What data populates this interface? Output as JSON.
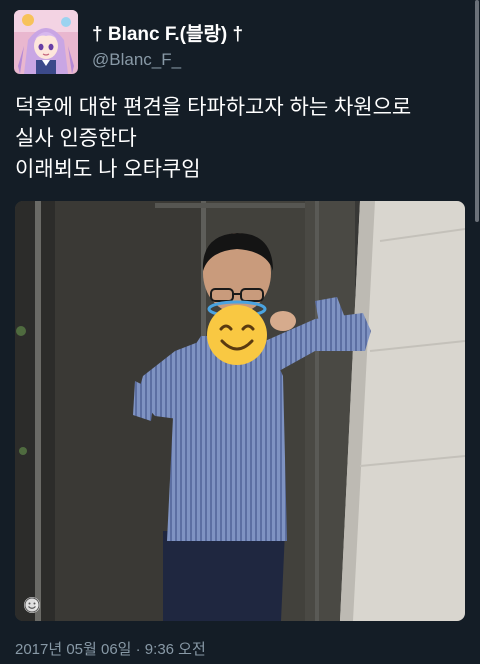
{
  "tweet": {
    "author_name": "† Blanc F.(블랑) †",
    "author_handle": "@Blanc_F_",
    "lines": [
      "덕후에 대한 편견을 타파하고자 하는 차원으로",
      "실사 인증한다",
      "이래뵈도 나 오타쿠임"
    ],
    "timestamp": "2017년 05월 06일 · 9:36 오전"
  },
  "icons": {
    "avatar": "anime-avatar-icon",
    "face_cover": "smiling-face-with-halo-emoji",
    "media_badge": "emoji-badge-icon"
  },
  "colors": {
    "background": "#141d26",
    "text_primary": "#ffffff",
    "text_secondary": "#8899a6"
  }
}
